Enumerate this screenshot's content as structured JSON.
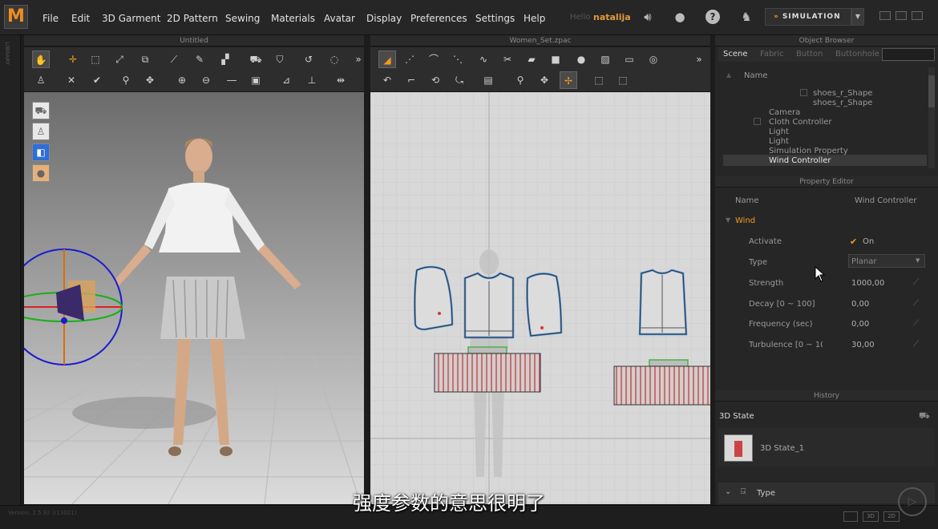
{
  "app": {
    "logo": "M",
    "hello": "Hello",
    "user": "natalija",
    "sim_label": "SIMULATION"
  },
  "menu": [
    "File",
    "Edit",
    "3D Garment",
    "2D Pattern",
    "Sewing",
    "Materials",
    "Avatar",
    "Display",
    "Preferences",
    "Settings",
    "Help"
  ],
  "left_strip": {
    "label": "LIBRARY"
  },
  "panels": {
    "view3d_title": "Untitled",
    "view2d_title": "Women_Set.zpac"
  },
  "object_browser": {
    "title": "Object Browser",
    "tabs": [
      "Scene",
      "Fabric",
      "Button",
      "Buttonhole"
    ],
    "column": "Name",
    "items": [
      "shoes_r_Shape",
      "shoes_r_Shape",
      "Camera",
      "Cloth Controller",
      "Light",
      "Light",
      "Simulation Property",
      "Wind Controller"
    ],
    "selected": "Wind Controller"
  },
  "property_editor": {
    "title": "Property Editor",
    "name_label": "Name",
    "name_value": "Wind Controller",
    "section": "Wind",
    "rows": [
      {
        "label": "Activate",
        "value": "On"
      },
      {
        "label": "Type",
        "value": "Planar"
      },
      {
        "label": "Strength",
        "value": "1000,00"
      },
      {
        "label": "Decay [0 ~ 100]",
        "value": "0,00"
      },
      {
        "label": "Frequency (sec)",
        "value": "0,00"
      },
      {
        "label": "Turbulence [0 ~ 100]",
        "value": "30,00"
      }
    ]
  },
  "history": {
    "title": "History",
    "state_header": "3D State",
    "state_item": "3D State_1",
    "type_label": "Type"
  },
  "subtitle": "强度参数的意思很明了",
  "status": {
    "version": "Version: 2.5.92    (r13021)",
    "view_buttons": [
      "3D",
      "2D"
    ]
  },
  "colors": {
    "accent": "#f39a1f",
    "selected_row": "#3a3a3a",
    "pattern_outline": "#5aa0e0"
  }
}
